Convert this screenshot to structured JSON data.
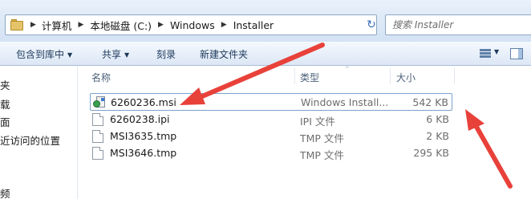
{
  "address_bar": {
    "separator_glyph": "▶",
    "crumbs": [
      "计算机",
      "本地磁盘 (C:)",
      "Windows",
      "Installer"
    ],
    "dropdown_glyph": "▼",
    "refresh_glyph": "↻"
  },
  "search": {
    "placeholder": "搜索 Installer"
  },
  "toolbar": {
    "include_in_library": "包含到库中",
    "share": "共享",
    "burn": "刻录",
    "new_folder": "新建文件夹",
    "caret_glyph": "▼"
  },
  "nav_pane": {
    "items": [
      "夹",
      "载",
      "面",
      "近访问的位置",
      "频"
    ]
  },
  "file_list": {
    "columns": {
      "name": "名称",
      "type": "类型",
      "size": "大小",
      "sort_glyph": "^"
    },
    "rows": [
      {
        "name": "6260236.msi",
        "type": "Windows Install...",
        "size": "542 KB",
        "icon": "msi-installer-icon",
        "selected": true
      },
      {
        "name": "6260238.ipi",
        "type": "IPI 文件",
        "size": "6 KB",
        "icon": "file-icon",
        "selected": false
      },
      {
        "name": "MSI3635.tmp",
        "type": "TMP 文件",
        "size": "2 KB",
        "icon": "file-icon",
        "selected": false
      },
      {
        "name": "MSI3646.tmp",
        "type": "TMP 文件",
        "size": "295 KB",
        "icon": "file-icon",
        "selected": false
      }
    ]
  },
  "annotation": {
    "arrow_color": "#e8413a"
  }
}
